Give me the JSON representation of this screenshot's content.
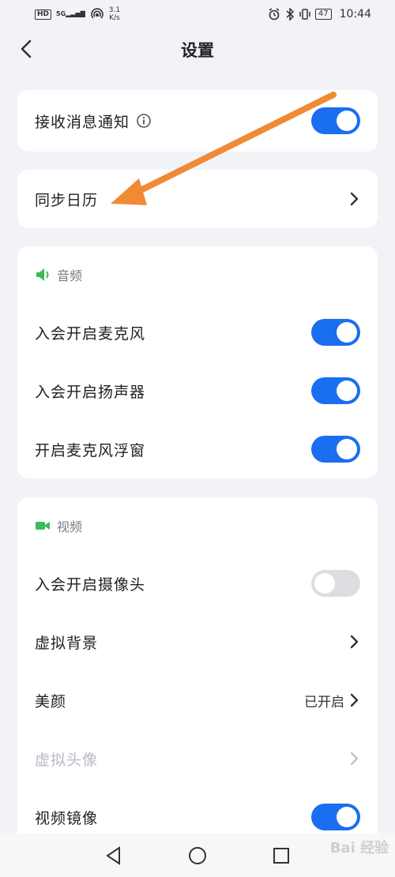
{
  "status_bar": {
    "hd": "HD",
    "signal": "5G",
    "speed_value": "3.1",
    "speed_unit": "K/s",
    "battery": "47",
    "time": "10:44"
  },
  "header": {
    "title": "设置"
  },
  "notify_card": {
    "label": "接收消息通知",
    "toggle_on": true
  },
  "calendar_card": {
    "label": "同步日历"
  },
  "audio_section": {
    "title": "音频",
    "icon_color": "#3dbb5b",
    "items": [
      {
        "label": "入会开启麦克风",
        "on": true
      },
      {
        "label": "入会开启扬声器",
        "on": true
      },
      {
        "label": "开启麦克风浮窗",
        "on": true
      }
    ]
  },
  "video_section": {
    "title": "视频",
    "icon_color": "#3dbb5b",
    "camera": {
      "label": "入会开启摄像头",
      "on": false
    },
    "virtual_bg": {
      "label": "虚拟背景"
    },
    "beauty": {
      "label": "美颜",
      "value": "已开启"
    },
    "virtual_avatar": {
      "label": "虚拟头像"
    },
    "mirror": {
      "label": "视频镜像",
      "on": true
    }
  },
  "watermark": "Bai 经验",
  "colors": {
    "accent": "#1a6ef0",
    "arrow": "#f08a35",
    "background": "#f2f3f7"
  }
}
